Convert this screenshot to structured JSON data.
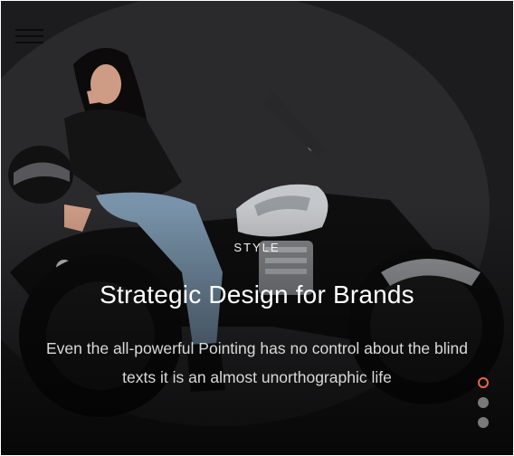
{
  "menu": {
    "icon": "hamburger-menu-icon"
  },
  "slide": {
    "eyebrow": "STYLE",
    "headline": "Strategic Design for Brands",
    "subtext": "Even the all-powerful Pointing has no control about the blind texts it is an almost unorthographic life"
  },
  "pagination": {
    "count": 3,
    "active_index": 0,
    "active_color": "#e8664a",
    "inactive_color": "#7a7a7a"
  }
}
